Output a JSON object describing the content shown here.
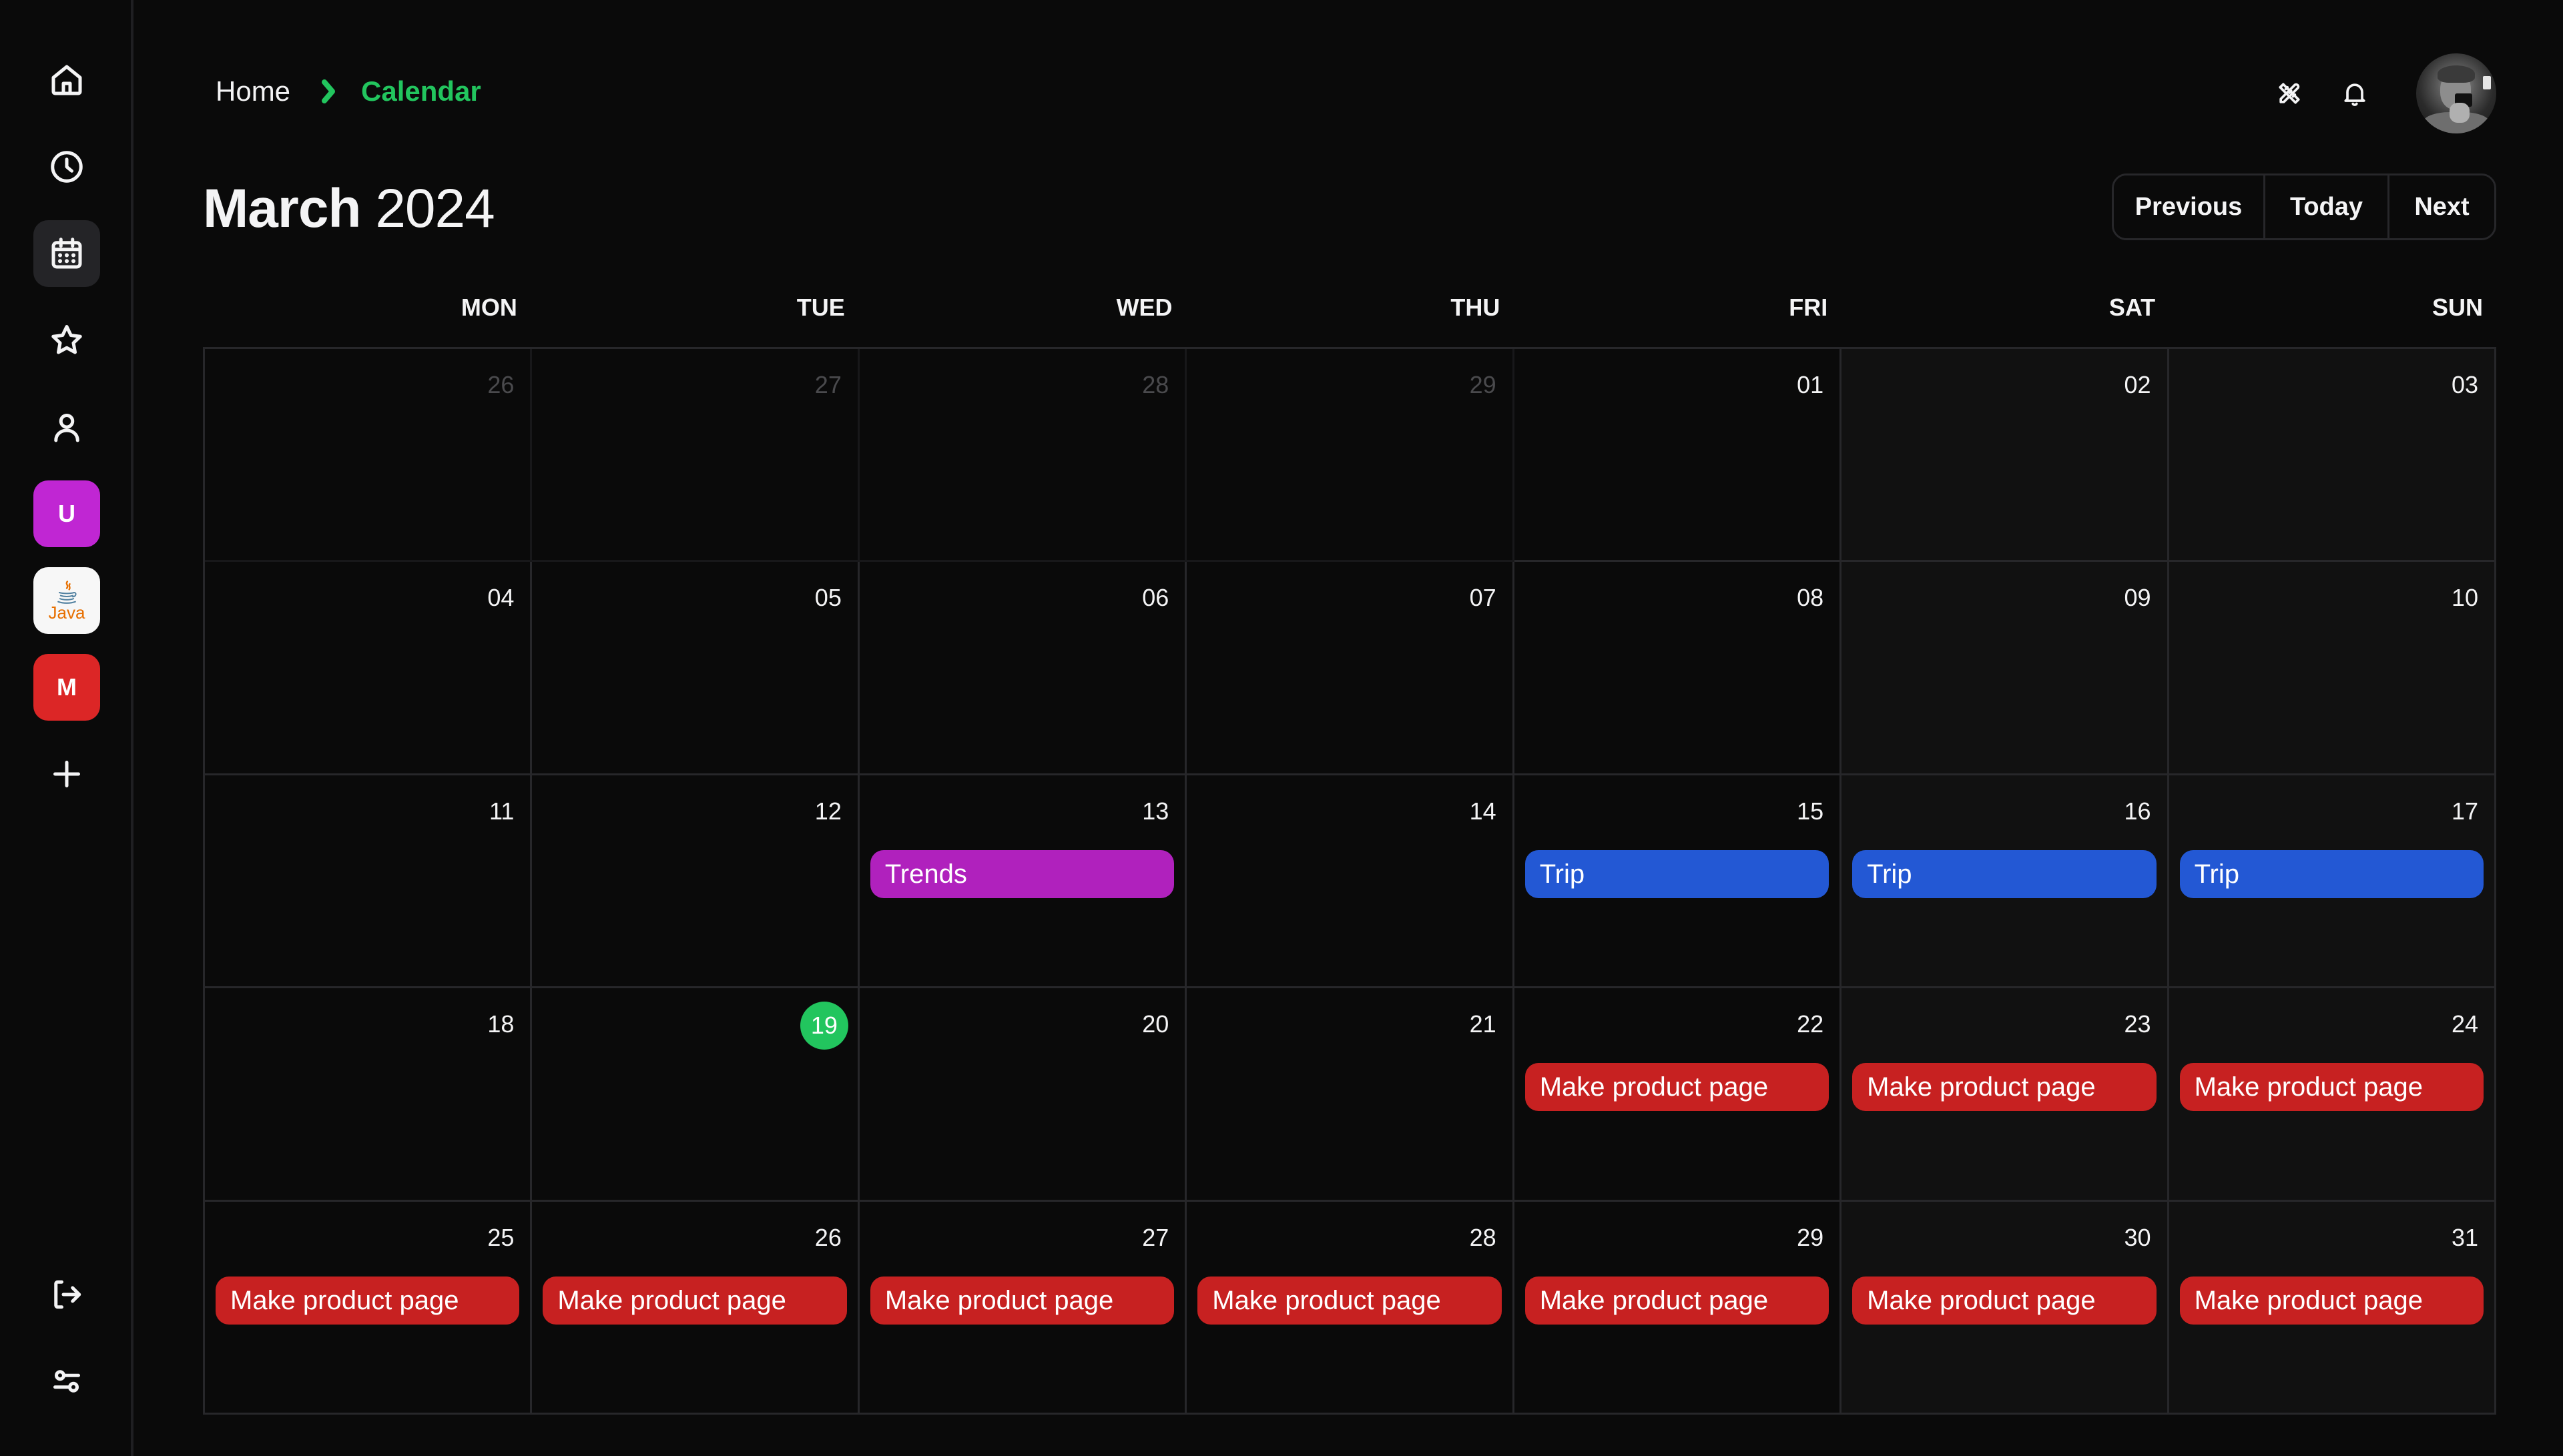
{
  "sidebar": {
    "nav": [
      {
        "id": "home",
        "icon": "home-icon",
        "active": false
      },
      {
        "id": "recent",
        "icon": "clock-icon",
        "active": false
      },
      {
        "id": "calendar",
        "icon": "calendar-icon",
        "active": true
      },
      {
        "id": "favorites",
        "icon": "star-icon",
        "active": false
      },
      {
        "id": "profile",
        "icon": "user-icon",
        "active": false
      }
    ],
    "apps": [
      {
        "label": "U",
        "color": "#c026d3"
      },
      {
        "label": "Java",
        "color": "#f7f7f7"
      },
      {
        "label": "M",
        "color": "#dc2626"
      }
    ],
    "add_icon": "plus-icon",
    "bottom": [
      {
        "id": "logout",
        "icon": "logout-icon"
      },
      {
        "id": "settings",
        "icon": "sliders-icon"
      }
    ]
  },
  "header": {
    "breadcrumb": {
      "home": "Home",
      "current": "Calendar"
    },
    "icons": [
      "tools-icon",
      "bell-icon"
    ],
    "avatar": "user-avatar"
  },
  "title": {
    "month": "March",
    "year": "2024"
  },
  "nav_buttons": {
    "previous": "Previous",
    "today": "Today",
    "next": "Next"
  },
  "weekdays": [
    "MON",
    "TUE",
    "WED",
    "THU",
    "FRI",
    "SAT",
    "SUN"
  ],
  "colors": {
    "accent": "#22c55e",
    "event_purple": "#b021bd",
    "event_blue": "#2358d4",
    "event_red": "#c72121"
  },
  "today": 19,
  "weeks": [
    [
      {
        "day": "26",
        "outside": true,
        "events": []
      },
      {
        "day": "27",
        "outside": true,
        "events": []
      },
      {
        "day": "28",
        "outside": true,
        "events": []
      },
      {
        "day": "29",
        "outside": true,
        "events": []
      },
      {
        "day": "01",
        "events": []
      },
      {
        "day": "02",
        "events": []
      },
      {
        "day": "03",
        "events": []
      }
    ],
    [
      {
        "day": "04",
        "events": []
      },
      {
        "day": "05",
        "events": []
      },
      {
        "day": "06",
        "events": []
      },
      {
        "day": "07",
        "events": []
      },
      {
        "day": "08",
        "events": []
      },
      {
        "day": "09",
        "events": []
      },
      {
        "day": "10",
        "events": []
      }
    ],
    [
      {
        "day": "11",
        "events": []
      },
      {
        "day": "12",
        "events": []
      },
      {
        "day": "13",
        "events": [
          {
            "title": "Trends",
            "color": "purple"
          }
        ]
      },
      {
        "day": "14",
        "events": []
      },
      {
        "day": "15",
        "events": [
          {
            "title": "Trip",
            "color": "blue"
          }
        ]
      },
      {
        "day": "16",
        "events": [
          {
            "title": "Trip",
            "color": "blue"
          }
        ]
      },
      {
        "day": "17",
        "events": [
          {
            "title": "Trip",
            "color": "blue"
          }
        ]
      }
    ],
    [
      {
        "day": "18",
        "events": []
      },
      {
        "day": "19",
        "today": true,
        "events": []
      },
      {
        "day": "20",
        "events": []
      },
      {
        "day": "21",
        "events": []
      },
      {
        "day": "22",
        "events": [
          {
            "title": "Make product page",
            "color": "red"
          }
        ]
      },
      {
        "day": "23",
        "events": [
          {
            "title": "Make product page",
            "color": "red"
          }
        ]
      },
      {
        "day": "24",
        "events": [
          {
            "title": "Make product page",
            "color": "red"
          }
        ]
      }
    ],
    [
      {
        "day": "25",
        "events": [
          {
            "title": "Make product page",
            "color": "red"
          }
        ]
      },
      {
        "day": "26",
        "events": [
          {
            "title": "Make product page",
            "color": "red"
          }
        ]
      },
      {
        "day": "27",
        "events": [
          {
            "title": "Make product page",
            "color": "red"
          }
        ]
      },
      {
        "day": "28",
        "events": [
          {
            "title": "Make product page",
            "color": "red"
          }
        ]
      },
      {
        "day": "29",
        "events": [
          {
            "title": "Make product page",
            "color": "red"
          }
        ]
      },
      {
        "day": "30",
        "events": [
          {
            "title": "Make product page",
            "color": "red"
          }
        ]
      },
      {
        "day": "31",
        "events": [
          {
            "title": "Make product page",
            "color": "red"
          }
        ]
      }
    ]
  ]
}
